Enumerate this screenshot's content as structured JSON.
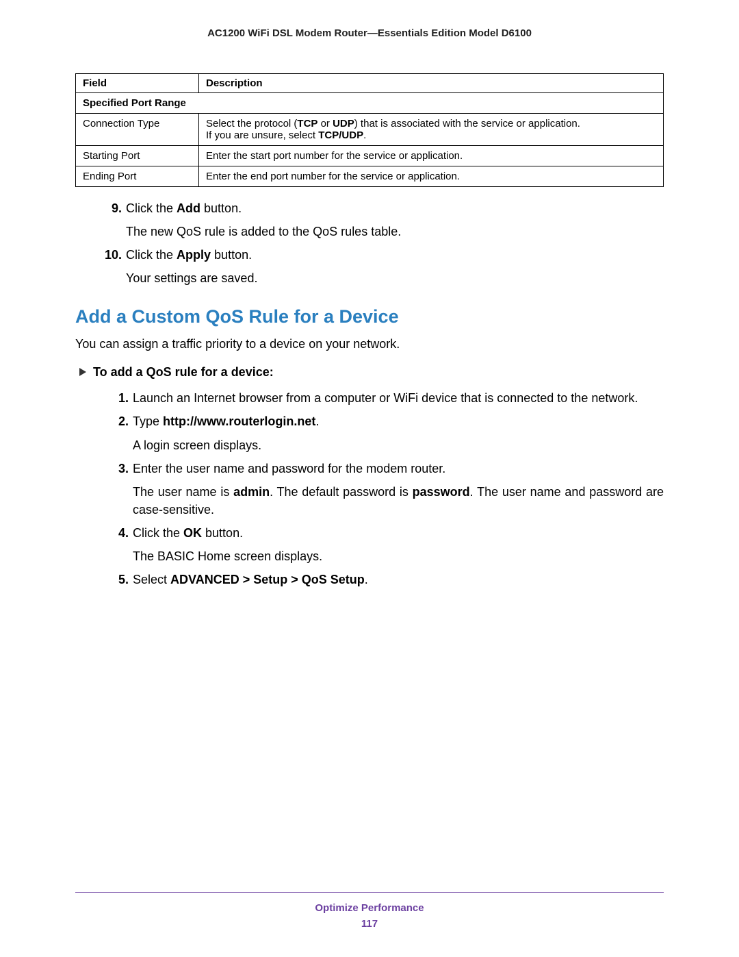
{
  "header": {
    "title": "AC1200 WiFi DSL Modem Router—Essentials Edition Model D6100"
  },
  "table": {
    "headers": {
      "field": "Field",
      "description": "Description"
    },
    "subhead": "Specified Port Range",
    "rows": [
      {
        "field": "Connection Type",
        "desc_pre": "Select the protocol (",
        "desc_b1": "TCP",
        "desc_mid": " or ",
        "desc_b2": "UDP",
        "desc_post1": ") that is associated with the service or application.",
        "desc_line2_pre": "If you are unsure, select ",
        "desc_line2_b": "TCP/UDP",
        "desc_line2_post": "."
      },
      {
        "field": "Starting Port",
        "desc_plain": "Enter the start port number for the service or application."
      },
      {
        "field": "Ending Port",
        "desc_plain": "Enter the end port number for the service or application."
      }
    ]
  },
  "steps_top": [
    {
      "num": "9.",
      "pre": "Click the ",
      "bold": "Add",
      "post": " button.",
      "follow": "The new QoS rule is added to the QoS rules table."
    },
    {
      "num": "10.",
      "pre": "Click the ",
      "bold": "Apply",
      "post": " button.",
      "follow": "Your settings are saved."
    }
  ],
  "section": {
    "heading": "Add a Custom QoS Rule for a Device",
    "intro": "You can assign a traffic priority to a device on your network.",
    "proc_label": "To add a QoS rule for a device:"
  },
  "steps_proc": {
    "s1": {
      "num": "1.",
      "text": "Launch an Internet browser from a computer or WiFi device that is connected to the network."
    },
    "s2": {
      "num": "2.",
      "pre": "Type ",
      "bold": "http://www.routerlogin.net",
      "post": ".",
      "follow": "A login screen displays."
    },
    "s3": {
      "num": "3.",
      "line1": "Enter the user name and password for the modem router.",
      "f_pre": "The user name is ",
      "f_b1": "admin",
      "f_mid": ". The default password is ",
      "f_b2": "password",
      "f_post": ". The user name and password are case-sensitive."
    },
    "s4": {
      "num": "4.",
      "pre": "Click the ",
      "bold": "OK",
      "post": " button.",
      "follow": "The BASIC Home screen displays."
    },
    "s5": {
      "num": "5.",
      "pre": "Select ",
      "bold": "ADVANCED > Setup > QoS Setup",
      "post": "."
    }
  },
  "footer": {
    "section": "Optimize Performance",
    "page": "117"
  }
}
